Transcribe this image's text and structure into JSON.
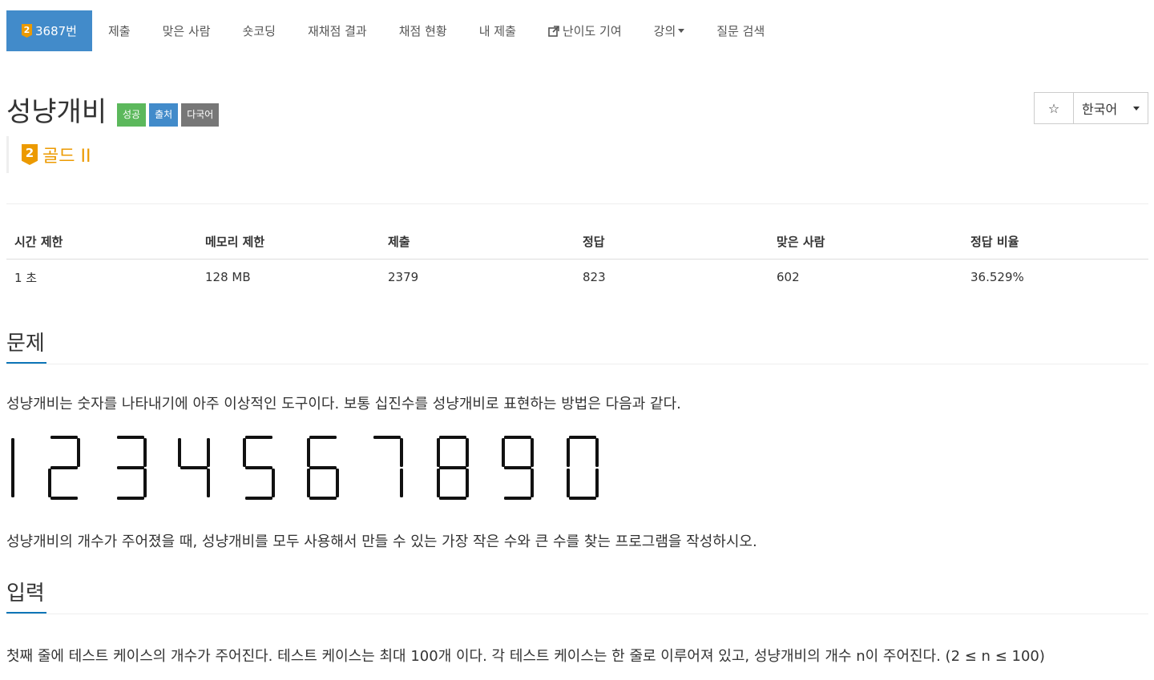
{
  "nav": {
    "problem_tab": {
      "tier_badge": "2",
      "label": "3687번"
    },
    "tabs": [
      {
        "label": "제출",
        "has_icon": false,
        "dropdown": false
      },
      {
        "label": "맞은 사람",
        "has_icon": false,
        "dropdown": false
      },
      {
        "label": "숏코딩",
        "has_icon": false,
        "dropdown": false
      },
      {
        "label": "재채점 결과",
        "has_icon": false,
        "dropdown": false
      },
      {
        "label": "채점 현황",
        "has_icon": false,
        "dropdown": false
      },
      {
        "label": "내 제출",
        "has_icon": false,
        "dropdown": false
      },
      {
        "label": "난이도 기여",
        "has_icon": true,
        "icon": "external-link-icon",
        "dropdown": false
      },
      {
        "label": "강의",
        "has_icon": false,
        "dropdown": true
      },
      {
        "label": "질문 검색",
        "has_icon": false,
        "dropdown": false
      }
    ]
  },
  "problem": {
    "title": "성냥개비",
    "labels": [
      "성공",
      "출처",
      "다국어"
    ],
    "label_colors": [
      "#5cb85c",
      "#428bca",
      "#777777"
    ],
    "tier_badge": "2",
    "tier": "골드 II",
    "tier_color": "#ec9a00"
  },
  "actions": {
    "star_icon": "☆",
    "language": "한국어"
  },
  "info_table": {
    "headers": [
      "시간 제한",
      "메모리 제한",
      "제출",
      "정답",
      "맞은 사람",
      "정답 비율"
    ],
    "values": [
      "1 초",
      "128 MB",
      "2379",
      "823",
      "602",
      "36.529%"
    ]
  },
  "sections": {
    "problem": {
      "heading": "문제",
      "para1": "성냥개비는 숫자를 나타내기에 아주 이상적인 도구이다. 보통 십진수를 성냥개비로 표현하는 방법은 다음과 같다.",
      "digits": [
        "1",
        "2",
        "3",
        "4",
        "5",
        "6",
        "7",
        "8",
        "9",
        "0"
      ],
      "para2": "성냥개비의 개수가 주어졌을 때, 성냥개비를 모두 사용해서 만들 수 있는 가장 작은 수와 큰 수를 찾는 프로그램을 작성하시오."
    },
    "input": {
      "heading": "입력",
      "para1": "첫째 줄에 테스트 케이스의 개수가 주어진다. 테스트 케이스는 최대 100개 이다. 각 테스트 케이스는 한 줄로 이루어져 있고, 성냥개비의 개수 n이 주어진다. (2 ≤ n ≤ 100)"
    }
  },
  "colors": {
    "accent": "#428bca",
    "section_underline": "#0e76b8",
    "text": "#333333"
  }
}
